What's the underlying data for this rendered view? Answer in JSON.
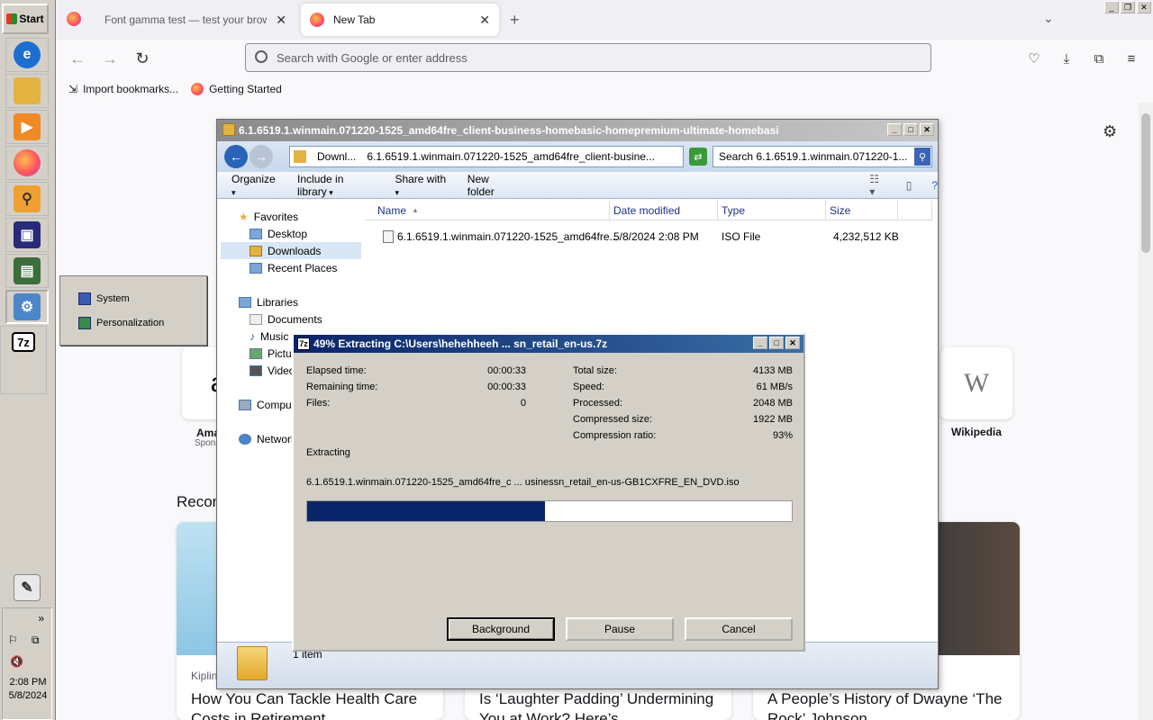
{
  "taskbar": {
    "start_label": "Start",
    "clock_time": "2:08 PM",
    "clock_date": "5/8/2024",
    "expand_label": "»"
  },
  "flyout": {
    "items": [
      {
        "label": "System"
      },
      {
        "label": "Personalization"
      }
    ]
  },
  "browser": {
    "tabs": [
      {
        "label": "Font gamma test — test your browser"
      },
      {
        "label": "New Tab"
      }
    ],
    "new_tab_label": "+",
    "url_placeholder": "Search with Google or enter address",
    "bookmarks": [
      {
        "label": "Import bookmarks..."
      },
      {
        "label": "Getting Started"
      }
    ],
    "shortcuts": [
      {
        "letter": "a",
        "label": "Ama",
        "sublabel": "Spon"
      },
      {
        "letter": "W",
        "label": "Wikipedia",
        "sublabel": ""
      }
    ],
    "section_heading": "Recon",
    "stories": [
      {
        "source": "Kiplin",
        "title": "How You Can Tackle Health Care Costs in Retirement",
        "img_color": "#a9d3ea"
      },
      {
        "source": "",
        "title": "Is ‘Laughter Padding’ Undermining You at Work? Here’s",
        "img_color": "#e6e6e6"
      },
      {
        "source": "",
        "title": "A People’s History of Dwayne ‘The Rock’ Johnson",
        "img_color": "#3a3a3a"
      }
    ]
  },
  "explorer": {
    "title": "6.1.6519.1.winmain.071220-1525_amd64fre_client-business-homebasic-homepremium-ultimate-homebasi",
    "breadcrumb_root": "Downl...",
    "breadcrumb_folder": "6.1.6519.1.winmain.071220-1525_amd64fre_client-busine...",
    "search_placeholder": "Search 6.1.6519.1.winmain.071220-1...",
    "toolbar": [
      "Organize",
      "Include in library",
      "Share with",
      "New folder"
    ],
    "nav": [
      {
        "label": "Favorites",
        "indent": 0
      },
      {
        "label": "Desktop",
        "indent": 1
      },
      {
        "label": "Downloads",
        "indent": 1,
        "selected": true
      },
      {
        "label": "Recent Places",
        "indent": 1
      },
      {
        "label": "Libraries",
        "indent": 0
      },
      {
        "label": "Documents",
        "indent": 1
      },
      {
        "label": "Music",
        "indent": 1
      },
      {
        "label": "Pictur",
        "indent": 1
      },
      {
        "label": "Video",
        "indent": 1
      },
      {
        "label": "Comput",
        "indent": 0
      },
      {
        "label": "Network",
        "indent": 0
      }
    ],
    "columns": [
      "Name",
      "Date modified",
      "Type",
      "Size"
    ],
    "files": [
      {
        "name": "6.1.6519.1.winmain.071220-1525_amd64fre...",
        "date": "5/8/2024 2:08 PM",
        "type": "ISO File",
        "size": "4,232,512 KB"
      }
    ],
    "status": "1 item"
  },
  "zip_dialog": {
    "title": "49% Extracting C:\\Users\\hehehheeh ... sn_retail_en-us.7z",
    "left_stats": [
      {
        "label": "Elapsed time:",
        "value": "00:00:33"
      },
      {
        "label": "Remaining time:",
        "value": "00:00:33"
      },
      {
        "label": "Files:",
        "value": "0"
      }
    ],
    "right_stats": [
      {
        "label": "Total size:",
        "value": "4133 MB"
      },
      {
        "label": "Speed:",
        "value": "61 MB/s"
      },
      {
        "label": "Processed:",
        "value": "2048 MB"
      },
      {
        "label": "Compressed size:",
        "value": "1922 MB"
      },
      {
        "label": "Compression ratio:",
        "value": "93%"
      }
    ],
    "operation": "Extracting",
    "current_file": "6.1.6519.1.winmain.071220-1525_amd64fre_c ... usinessn_retail_en-us-GB1CXFRE_EN_DVD.iso",
    "progress_fraction": 0.49,
    "buttons": [
      "Background",
      "Pause",
      "Cancel"
    ]
  }
}
